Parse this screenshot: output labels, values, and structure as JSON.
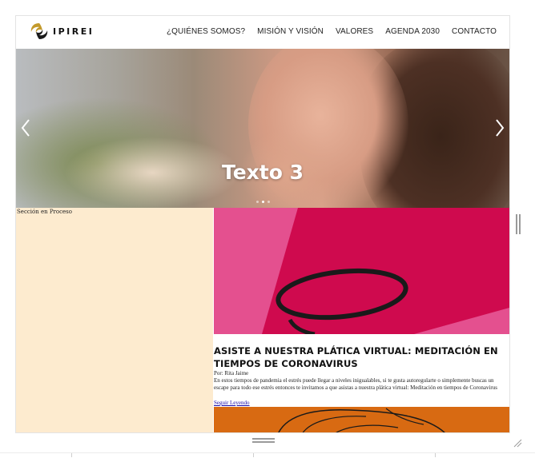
{
  "brand": {
    "name": "IPIREI",
    "colors": {
      "gold": "#c39a2c",
      "dark": "#1a1a1a"
    }
  },
  "nav": {
    "items": [
      {
        "label": "¿QUIÉNES SOMOS?"
      },
      {
        "label": "MISIÓN Y VISIÓN"
      },
      {
        "label": "VALORES"
      },
      {
        "label": "AGENDA 2030"
      },
      {
        "label": "CONTACTO"
      }
    ]
  },
  "hero": {
    "caption": "Texto 3",
    "prev_icon": "chevron-left-icon",
    "next_icon": "chevron-right-icon",
    "slide_count": 3,
    "active_slide": 2
  },
  "left_panel": {
    "label": "Sección en Proceso",
    "background": "#fdebcf"
  },
  "post": {
    "title": "ASISTE A NUESTRA PLÁTICA VIRTUAL: MEDITACIÓN EN TIEMPOS DE CORONAVIRUS",
    "author": "Por: Rita Jaime",
    "excerpt": "En estos tiempos de pandemia el estrés puede llegar a niveles inigualables, si te gusta autoregularte o simplemente buscas un escape para todo ese estrés entonces te invitamos a que asistas a nuestra plática virtual: Meditación en tiempos de Coronavirus",
    "link_label": "Seguir Leyendo",
    "image_colors": {
      "background": "#e4508f",
      "shape": "#cf0a4e"
    }
  },
  "post2": {
    "image_color": "#d86a12"
  }
}
